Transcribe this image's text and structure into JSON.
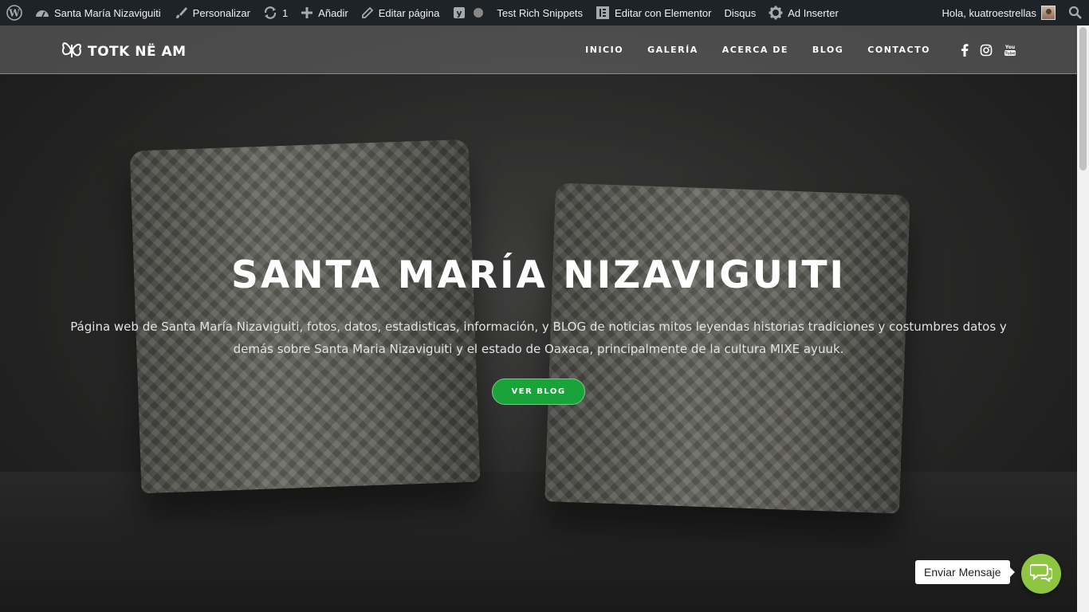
{
  "admin_bar": {
    "site_name": "Santa María Nizaviguiti",
    "customize": "Personalizar",
    "updates_count": "1",
    "new": "Añadir",
    "edit_page": "Editar página",
    "rich_snippets": "Test Rich Snippets",
    "elementor": "Editar con Elementor",
    "disqus": "Disqus",
    "ad_inserter": "Ad Inserter",
    "greeting": "Hola, kuatroestrellas"
  },
  "header": {
    "logo_text": "TOTK NË AM",
    "nav": [
      {
        "label": "INICIO"
      },
      {
        "label": "GALERÍA"
      },
      {
        "label": "ACERCA DE"
      },
      {
        "label": "BLOG"
      },
      {
        "label": "CONTACTO"
      }
    ],
    "social_icons": [
      "facebook-icon",
      "instagram-icon",
      "youtube-icon"
    ]
  },
  "hero": {
    "title": "SANTA MARÍA NIZAVIGUITI",
    "description": "Página web de Santa María Nizaviguiti, fotos, datos, estadisticas, información, y BLOG de noticias mitos leyendas historias tradiciones y costumbres datos y demás sobre Santa Maria Nizaviguiti y el estado de Oaxaca, principalmente de la cultura MIXE ayuuk.",
    "button": "VER BLOG"
  },
  "chat": {
    "label": "Enviar Mensaje"
  },
  "colors": {
    "admin_bar": "#1d2327",
    "button_green": "#1aa33b",
    "chat_green": "#8ec642"
  }
}
